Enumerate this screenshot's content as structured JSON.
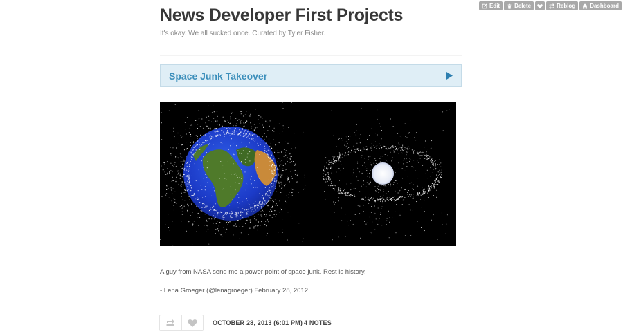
{
  "toolbar": {
    "edit_label": "Edit",
    "delete_label": "Delete",
    "reblog_label": "Reblog",
    "dashboard_label": "Dashboard",
    "icons": [
      "edit-icon",
      "trash-icon",
      "heart-icon",
      "reblog-icon",
      "home-icon"
    ]
  },
  "blog": {
    "title": "News Developer First Projects",
    "description": "It's okay. We all sucked once. Curated by Tyler Fisher."
  },
  "post": {
    "link_title": "Space Junk Takeover",
    "link_icon": "play-arrow-icon",
    "quote": "A guy from NASA send me a power point of space junk. Rest is history.",
    "source": "- Lena Groeger (@lenagroeger)  February 28, 2012",
    "date": "OCTOBER 28, 2013 (6:01 PM)",
    "notes": "4 NOTES"
  },
  "colors": {
    "link_bg": "#dfeef6",
    "link_text": "#3d8fbb",
    "toolbar_bg": "#a9a9a9"
  }
}
